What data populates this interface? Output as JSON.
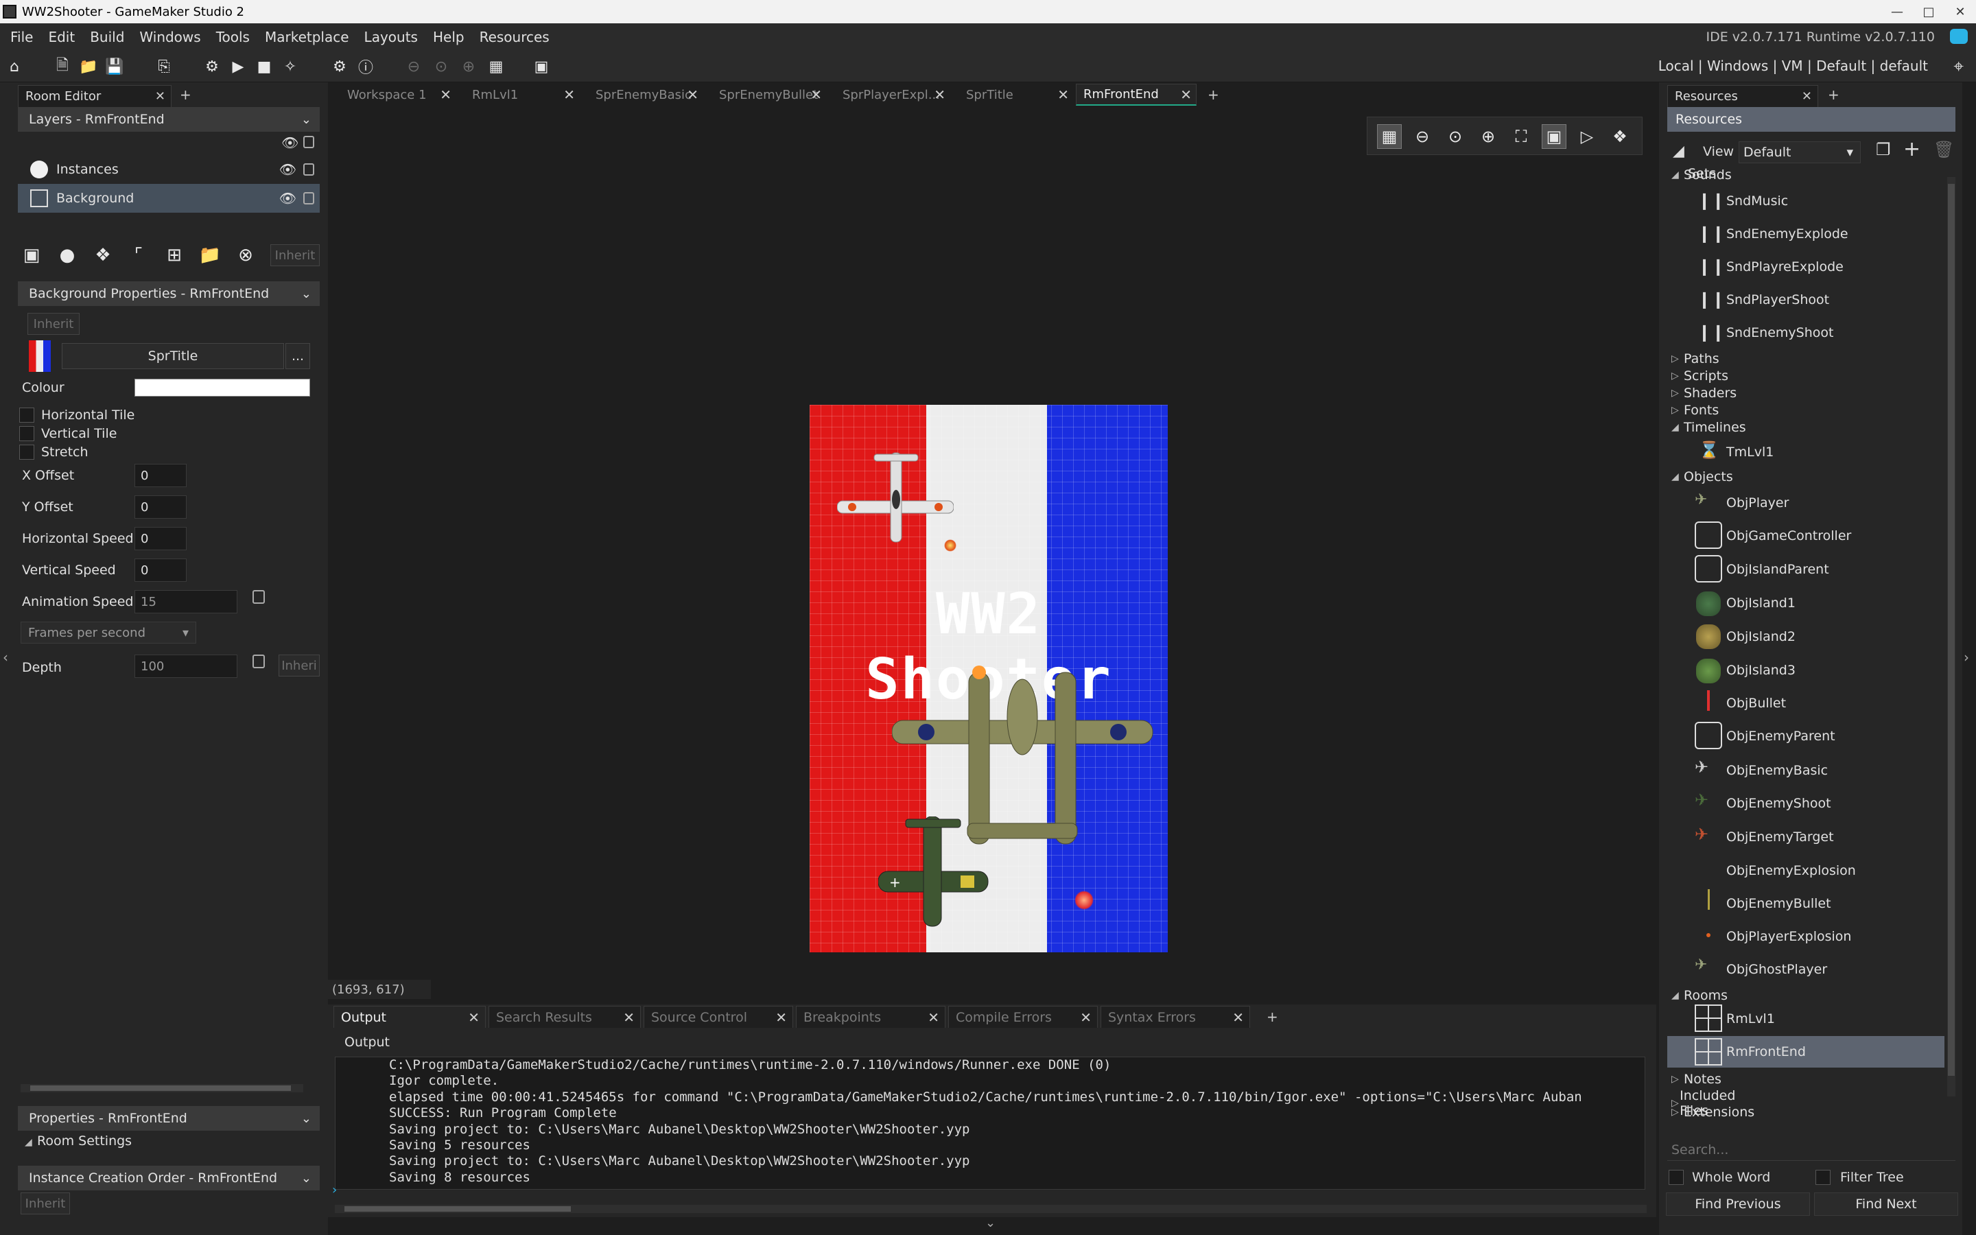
{
  "window": {
    "title": "WW2Shooter - GameMaker Studio 2",
    "controls": [
      "minimize-icon",
      "maximize-icon",
      "close-icon"
    ]
  },
  "menu": {
    "items": [
      "File",
      "Edit",
      "Build",
      "Windows",
      "Tools",
      "Marketplace",
      "Layouts",
      "Help",
      "Resources"
    ],
    "version": "IDE v2.0.7.171 Runtime v2.0.7.110"
  },
  "toolbar": {
    "target": "Local | Windows | VM | Default | default"
  },
  "room_editor": {
    "tab_label": "Room Editor",
    "layers_header": "Layers - RmFrontEnd",
    "layers": [
      {
        "name": "Instances"
      },
      {
        "name": "Background",
        "selected": true
      }
    ],
    "inherit_label": "Inherit",
    "bg_props_header": "Background Properties - RmFrontEnd",
    "sprite_name": "SprTitle",
    "sprite_more": "...",
    "colour_label": "Colour",
    "colour_value": "#ffffff",
    "horizontal_tile": "Horizontal Tile",
    "vertical_tile": "Vertical Tile",
    "stretch": "Stretch",
    "x_offset_label": "X Offset",
    "x_offset": "0",
    "y_offset_label": "Y Offset",
    "y_offset": "0",
    "h_speed_label": "Horizontal Speed",
    "h_speed": "0",
    "v_speed_label": "Vertical Speed",
    "v_speed": "0",
    "anim_speed_label": "Animation Speed:",
    "anim_speed": "15",
    "anim_unit": "Frames per second",
    "depth_label": "Depth",
    "depth": "100",
    "depth_inherit": "Inheri",
    "properties_header": "Properties - RmFrontEnd",
    "room_settings": "Room Settings",
    "creation_order_header": "Instance Creation Order - RmFrontEnd",
    "creation_inherit": "Inherit"
  },
  "doc_tabs": [
    {
      "label": "Workspace 1",
      "active": false
    },
    {
      "label": "RmLvl1",
      "active": false
    },
    {
      "label": "SprEnemyBasic",
      "active": false
    },
    {
      "label": "SprEnemyBullet",
      "active": false
    },
    {
      "label": "SprPlayerExpl...",
      "active": false
    },
    {
      "label": "SprTitle",
      "active": false
    },
    {
      "label": "RmFrontEnd",
      "active": true
    }
  ],
  "canvas": {
    "coords": "(1693, 617)",
    "title_text": "WW2 Shooter",
    "colors": {
      "red": "#e01818",
      "white": "#ededed",
      "blue": "#1a2ee0"
    }
  },
  "output": {
    "tabs": [
      {
        "label": "Output",
        "active": true
      },
      {
        "label": "Search Results",
        "active": false
      },
      {
        "label": "Source Control",
        "active": false
      },
      {
        "label": "Breakpoints",
        "active": false
      },
      {
        "label": "Compile Errors",
        "active": false
      },
      {
        "label": "Syntax Errors",
        "active": false
      }
    ],
    "header": "Output",
    "lines": [
      "C:\\ProgramData/GameMakerStudio2/Cache/runtimes\\runtime-2.0.7.110/windows/Runner.exe DONE (0)",
      "Igor complete.",
      "elapsed time 00:00:41.5245465s for command \"C:\\ProgramData/GameMakerStudio2/Cache/runtimes\\runtime-2.0.7.110/bin/Igor.exe\" -options=\"C:\\Users\\Marc Auban",
      "SUCCESS: Run Program Complete",
      "Saving project to: C:\\Users\\Marc Aubanel\\Desktop\\WW2Shooter\\WW2Shooter.yyp",
      "Saving 5 resources",
      "Saving project to: C:\\Users\\Marc Aubanel\\Desktop\\WW2Shooter\\WW2Shooter.yyp",
      "Saving 8 resources"
    ]
  },
  "resources": {
    "tab_label": "Resources",
    "header": "Resources",
    "view_label": "View",
    "view_value": "Default",
    "clipped_group": "Tile Sets",
    "groups": {
      "sounds": "Sounds",
      "paths": "Paths",
      "scripts": "Scripts",
      "shaders": "Shaders",
      "fonts": "Fonts",
      "timelines": "Timelines",
      "objects": "Objects",
      "rooms": "Rooms",
      "notes": "Notes",
      "included_files": "Included Files",
      "extensions": "Extensions"
    },
    "sounds": [
      "SndMusic",
      "SndEnemyExplode",
      "SndPlayreExplode",
      "SndPlayerShoot",
      "SndEnemyShoot"
    ],
    "timelines": [
      "TmLvl1"
    ],
    "objects": [
      "ObjPlayer",
      "ObjGameController",
      "ObjIslandParent",
      "ObjIsland1",
      "ObjIsland2",
      "ObjIsland3",
      "ObjBullet",
      "ObjEnemyParent",
      "ObjEnemyBasic",
      "ObjEnemyShoot",
      "ObjEnemyTarget",
      "ObjEnemyExplosion",
      "ObjEnemyBullet",
      "ObjPlayerExplosion",
      "ObjGhostPlayer"
    ],
    "rooms": [
      "RmLvl1",
      "RmFrontEnd"
    ],
    "search_placeholder": "Search...",
    "whole_word": "Whole Word",
    "filter_tree": "Filter Tree",
    "find_previous": "Find Previous",
    "find_next": "Find Next"
  }
}
